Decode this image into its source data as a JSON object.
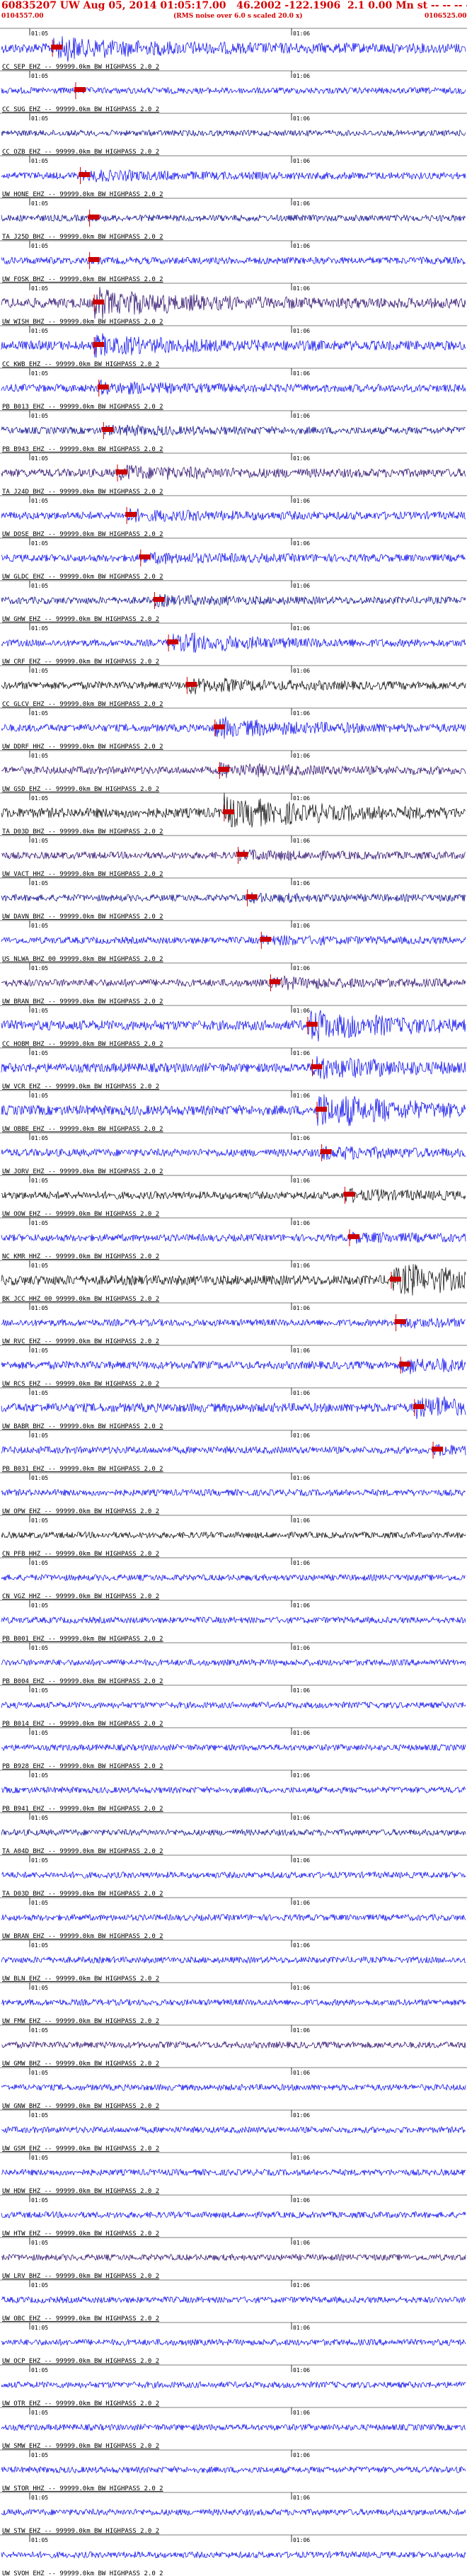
{
  "header": {
    "title": "60835207 UW Aug 05, 2014 01:05:17.00   46.2002 -122.1906  2.1 0.00 Mn st -- -- -- -1",
    "start_time": "0104557.00",
    "note": "(RMS noise over 6.0 s scaled 20.0 x)",
    "end_time": "0106525.00"
  },
  "chart_data": {
    "type": "line",
    "minute_labels": [
      "01:05",
      "01:06"
    ],
    "colors": {
      "title": "#d40000",
      "pick": "#cc0000",
      "trace_blue": "#0000ee",
      "trace_dark": "#220066",
      "trace_black": "#000000",
      "separator": "#000000"
    },
    "traces": [
      {
        "label": "CC SEP EHZ -- 99999.0km BW  HIGHPASS  2.0  2",
        "color": "#0000ee",
        "amp": 1.0,
        "pick": 0.11,
        "event": 0.45
      },
      {
        "label": "CC SUG EHZ -- 99999.0km BW  HIGHPASS  2.0  2",
        "color": "#0000ee",
        "amp": 0.35,
        "pick": 0.16,
        "event": 0.0
      },
      {
        "label": "CC OZB EHZ -- 99999.0km BW  HIGHPASS  2.0  2",
        "color": "#000088",
        "amp": 0.3,
        "pick": 0.0,
        "event": 0.0
      },
      {
        "label": "UW HONE EHZ -- 99999.0km BW  HIGHPASS  2.0  2",
        "color": "#0000ee",
        "amp": 0.5,
        "pick": 0.17,
        "event": 0.35
      },
      {
        "label": "TA J25D BHZ -- 99999.0km BW  HIGHPASS  2.0  2",
        "color": "#000088",
        "amp": 0.4,
        "pick": 0.19,
        "event": 0.0
      },
      {
        "label": "UW FOSK BHZ -- 99999.0km BW  HIGHPASS  2.0  2",
        "color": "#0000ee",
        "amp": 0.5,
        "pick": 0.19,
        "event": 0.0
      },
      {
        "label": "UW WISH BHZ -- 99999.0km BW  HIGHPASS  2.0  2",
        "color": "#220066",
        "amp": 1.0,
        "pick": 0.2,
        "event": 0.55
      },
      {
        "label": "CC KWB EHZ -- 99999.0km BW  HIGHPASS  2.0  2",
        "color": "#0000ee",
        "amp": 0.9,
        "pick": 0.2,
        "event": 0.4
      },
      {
        "label": "PB B013 EHZ -- 99999.0km BW  HIGHPASS  2.0  2",
        "color": "#0000ee",
        "amp": 0.6,
        "pick": 0.21,
        "event": 0.3
      },
      {
        "label": "PB B943 EHZ -- 99999.0km BW  HIGHPASS  2.0  2",
        "color": "#000088",
        "amp": 0.5,
        "pick": 0.22,
        "event": 0.3
      },
      {
        "label": "TA J24D BHZ -- 99999.0km BW  HIGHPASS  2.0  2",
        "color": "#220066",
        "amp": 0.7,
        "pick": 0.25,
        "event": 0.35
      },
      {
        "label": "UW DOSE BHZ -- 99999.0km BW  HIGHPASS  2.0  2",
        "color": "#0000ee",
        "amp": 0.6,
        "pick": 0.27,
        "event": 0.3
      },
      {
        "label": "UW GLDC EHZ -- 99999.0km BW  HIGHPASS  2.0  2",
        "color": "#0000ee",
        "amp": 0.55,
        "pick": 0.3,
        "event": 0.3
      },
      {
        "label": "UW GHW EHZ -- 99999.0km BW  HIGHPASS  2.0  2",
        "color": "#000088",
        "amp": 0.5,
        "pick": 0.33,
        "event": 0.3
      },
      {
        "label": "UW CRF EHZ -- 99999.0km BW  HIGHPASS  2.0  2",
        "color": "#0000ee",
        "amp": 0.45,
        "pick": 0.36,
        "event": 0.9
      },
      {
        "label": "CC GLCV EHZ -- 99999.0km BW  HIGHPASS  2.0  2",
        "color": "#000000",
        "amp": 0.6,
        "pick": 0.4,
        "event": 0.4
      },
      {
        "label": "UW DDRF HHZ -- 99999.0km BW  HIGHPASS  2.0  2",
        "color": "#0000ee",
        "amp": 0.6,
        "pick": 0.46,
        "event": 0.6
      },
      {
        "label": "UW GSD EHZ -- 99999.0km BW  HIGHPASS  2.0  2",
        "color": "#220066",
        "amp": 0.6,
        "pick": 0.47,
        "event": 0.35
      },
      {
        "label": "TA D03D BHZ -- 99999.0km BW  HIGHPASS  2.0  2",
        "color": "#000000",
        "amp": 1.0,
        "pick": 0.48,
        "event": 0.65
      },
      {
        "label": "UW VACT HHZ -- 99999.0km BW  HIGHPASS  2.0  2",
        "color": "#220066",
        "amp": 0.5,
        "pick": 0.51,
        "event": 0.3
      },
      {
        "label": "UW DAVN BHZ -- 99999.0km BW  HIGHPASS  2.0  2",
        "color": "#000088",
        "amp": 0.45,
        "pick": 0.53,
        "event": 0.25
      },
      {
        "label": "US NLWA BHZ 00 99999.0km BW  HIGHPASS  2.0  2",
        "color": "#0000ee",
        "amp": 0.45,
        "pick": 0.56,
        "event": 0.3
      },
      {
        "label": "UW BRAN BHZ -- 99999.0km BW  HIGHPASS  2.0  2",
        "color": "#220066",
        "amp": 0.55,
        "pick": 0.58,
        "event": 0.35
      },
      {
        "label": "CC HOBM BHZ -- 99999.0km BW  HIGHPASS  2.0  2",
        "color": "#0000ee",
        "amp": 1.0,
        "pick": 0.66,
        "event": 0.6
      },
      {
        "label": "UW VCR EHZ -- 99999.0km BW  HIGHPASS  2.0  2",
        "color": "#0000ee",
        "amp": 0.9,
        "pick": 0.67,
        "event": 0.5
      },
      {
        "label": "UW OBBE EHZ -- 99999.0km BW  HIGHPASS  2.0  2",
        "color": "#0000ee",
        "amp": 1.0,
        "pick": 0.68,
        "event": 0.7
      },
      {
        "label": "UW JORV EHZ -- 99999.0km BW  HIGHPASS  2.0  2",
        "color": "#0000ee",
        "amp": 0.6,
        "pick": 0.69,
        "event": 0.35
      },
      {
        "label": "UW OOW EHZ -- 99999.0km BW  HIGHPASS  2.0  2",
        "color": "#000000",
        "amp": 0.6,
        "pick": 0.74,
        "event": 0.3
      },
      {
        "label": "NC KMR HHZ -- 99999.0km BW  HIGHPASS  2.0  2",
        "color": "#0000ee",
        "amp": 0.5,
        "pick": 0.75,
        "event": 0.3
      },
      {
        "label": "BK JCC HHZ 00 99999.0km BW  HIGHPASS  2.0  2",
        "color": "#000000",
        "amp": 1.0,
        "pick": 0.84,
        "event": 0.65
      },
      {
        "label": "UW RVC EHZ -- 99999.0km BW  HIGHPASS  2.0  2",
        "color": "#0000ee",
        "amp": 0.45,
        "pick": 0.85,
        "event": 0.3
      },
      {
        "label": "UW RCS EHZ -- 99999.0km BW  HIGHPASS  2.0  2",
        "color": "#0000ee",
        "amp": 0.65,
        "pick": 0.86,
        "event": 0.4
      },
      {
        "label": "UW BABR BHZ -- 99999.0km BW  HIGHPASS  2.0  2",
        "color": "#0000ee",
        "amp": 0.85,
        "pick": 0.89,
        "event": 0.55
      },
      {
        "label": "PB B031 EHZ -- 99999.0km BW  HIGHPASS  2.0  2",
        "color": "#0000ee",
        "amp": 0.5,
        "pick": 0.93,
        "event": 0.3
      },
      {
        "label": "UW OPW EHZ -- 99999.0km BW  HIGHPASS  2.0  2",
        "color": "#0000ee",
        "amp": 0.4,
        "pick": 0.0,
        "event": 0.0
      },
      {
        "label": "CN PFB HHZ -- 99999.0km BW  HIGHPASS  2.0  2",
        "color": "#000000",
        "amp": 0.35,
        "pick": 0.0,
        "event": 0.0
      },
      {
        "label": "CN VGZ HHZ -- 99999.0km BW  HIGHPASS  2.0  2",
        "color": "#0000ee",
        "amp": 0.35,
        "pick": 0.0,
        "event": 0.0
      },
      {
        "label": "PB B001 EHZ -- 99999.0km BW  HIGHPASS  2.0  2",
        "color": "#0000ee",
        "amp": 0.35,
        "pick": 0.0,
        "event": 0.0
      },
      {
        "label": "PB B004 EHZ -- 99999.0km BW  HIGHPASS  2.0  2",
        "color": "#0000ee",
        "amp": 0.35,
        "pick": 0.0,
        "event": 0.0
      },
      {
        "label": "PB B014 EHZ -- 99999.0km BW  HIGHPASS  2.0  2",
        "color": "#0000ee",
        "amp": 0.35,
        "pick": 0.0,
        "event": 0.0
      },
      {
        "label": "PB B928 EHZ -- 99999.0km BW  HIGHPASS  2.0  2",
        "color": "#0000ee",
        "amp": 0.35,
        "pick": 0.0,
        "event": 0.0
      },
      {
        "label": "PB B941 EHZ -- 99999.0km BW  HIGHPASS  2.0  2",
        "color": "#0000ee",
        "amp": 0.35,
        "pick": 0.0,
        "event": 0.0
      },
      {
        "label": "TA A04D BHZ -- 99999.0km BW  HIGHPASS  2.0  2",
        "color": "#000088",
        "amp": 0.35,
        "pick": 0.0,
        "event": 0.0
      },
      {
        "label": "TA D03D BHZ -- 99999.0km BW  HIGHPASS  2.0  2",
        "color": "#0000ee",
        "amp": 0.35,
        "pick": 0.0,
        "event": 0.0
      },
      {
        "label": "UW BRAN EHZ -- 99999.0km BW  HIGHPASS  2.0  2",
        "color": "#0000ee",
        "amp": 0.35,
        "pick": 0.0,
        "event": 0.0
      },
      {
        "label": "UW BLN EHZ -- 99999.0km BW  HIGHPASS  2.0  2",
        "color": "#0000ee",
        "amp": 0.35,
        "pick": 0.0,
        "event": 0.0
      },
      {
        "label": "UW FMW EHZ -- 99999.0km BW  HIGHPASS  2.0  2",
        "color": "#0000ee",
        "amp": 0.35,
        "pick": 0.0,
        "event": 0.0
      },
      {
        "label": "UW GMW BHZ -- 99999.0km BW  HIGHPASS  2.0  2",
        "color": "#220066",
        "amp": 0.4,
        "pick": 0.0,
        "event": 0.0
      },
      {
        "label": "UW GNW BHZ -- 99999.0km BW  HIGHPASS  2.0  2",
        "color": "#0000ee",
        "amp": 0.35,
        "pick": 0.0,
        "event": 0.0
      },
      {
        "label": "UW GSM EHZ -- 99999.0km BW  HIGHPASS  2.0  2",
        "color": "#0000ee",
        "amp": 0.35,
        "pick": 0.0,
        "event": 0.0
      },
      {
        "label": "UW HDW EHZ -- 99999.0km BW  HIGHPASS  2.0  2",
        "color": "#0000ee",
        "amp": 0.35,
        "pick": 0.0,
        "event": 0.0
      },
      {
        "label": "UW HTW EHZ -- 99999.0km BW  HIGHPASS  2.0  2",
        "color": "#0000ee",
        "amp": 0.35,
        "pick": 0.0,
        "event": 0.0
      },
      {
        "label": "UW LRV BHZ -- 99999.0km BW  HIGHPASS  2.0  2",
        "color": "#220066",
        "amp": 0.35,
        "pick": 0.0,
        "event": 0.0
      },
      {
        "label": "UW OBC EHZ -- 99999.0km BW  HIGHPASS  2.0  2",
        "color": "#0000ee",
        "amp": 0.35,
        "pick": 0.0,
        "event": 0.0
      },
      {
        "label": "UW OCP EHZ -- 99999.0km BW  HIGHPASS  2.0  2",
        "color": "#0000ee",
        "amp": 0.35,
        "pick": 0.0,
        "event": 0.0
      },
      {
        "label": "UW OTR EHZ -- 99999.0km BW  HIGHPASS  2.0  2",
        "color": "#0000ee",
        "amp": 0.35,
        "pick": 0.0,
        "event": 0.0
      },
      {
        "label": "UW SMW EHZ -- 99999.0km BW  HIGHPASS  2.0  2",
        "color": "#0000ee",
        "amp": 0.35,
        "pick": 0.0,
        "event": 0.0
      },
      {
        "label": "UW STOR HHZ -- 99999.0km BW  HIGHPASS  2.0  2",
        "color": "#0000ee",
        "amp": 0.35,
        "pick": 0.0,
        "event": 0.0
      },
      {
        "label": "UW STW EHZ -- 99999.0km BW  HIGHPASS  2.0  2",
        "color": "#0000ee",
        "amp": 0.35,
        "pick": 0.0,
        "event": 0.0
      },
      {
        "label": "UW SVOH EHZ -- 99999.0km BW  HIGHPASS  2.0  2",
        "color": "#0000ee",
        "amp": 0.35,
        "pick": 0.0,
        "event": 0.0
      }
    ]
  }
}
